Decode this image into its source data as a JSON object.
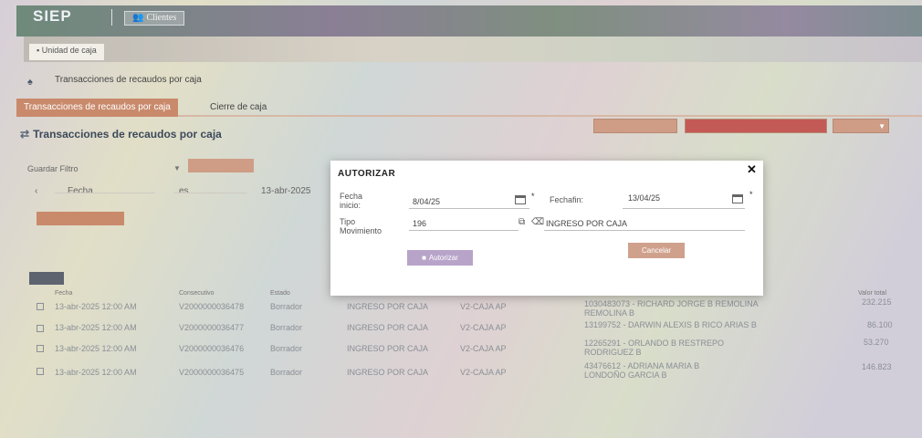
{
  "header": {
    "logo": "SIEP",
    "clientes_label": "Clientes",
    "unidad_tab": "Unidad de caja"
  },
  "breadcrumb": {
    "page": "Transacciones de recaudos por caja"
  },
  "tabs": [
    {
      "label": "Transacciones de recaudos por caja"
    },
    {
      "label": "Cierre de caja"
    }
  ],
  "section": {
    "title": "Transacciones de recaudos por caja"
  },
  "filters": {
    "guardar_label": "Guardar Filtro",
    "field1": "Fecha",
    "field2": "es",
    "field3": "13-abr-2025"
  },
  "table": {
    "headers": [
      "Fecha",
      "Consecutivo",
      "Estado",
      "Valor total"
    ],
    "rows": [
      {
        "fecha": "13-abr-2025 12:00 AM",
        "consecutivo": "V2000000036478",
        "estado": "Borrador",
        "tipo": "INGRESO POR CAJA",
        "caja": "V2-CAJA AP",
        "tercero": "1030483073 - RICHARD JORGE B REMOLINA REMOLINA B",
        "valor": "232.215"
      },
      {
        "fecha": "13-abr-2025 12:00 AM",
        "consecutivo": "V2000000036477",
        "estado": "Borrador",
        "tipo": "INGRESO POR CAJA",
        "caja": "V2-CAJA AP",
        "tercero": "13199752 - DARWIN ALEXIS B RICO ARIAS B",
        "valor": "86.100"
      },
      {
        "fecha": "13-abr-2025 12:00 AM",
        "consecutivo": "V2000000036476",
        "estado": "Borrador",
        "tipo": "INGRESO POR CAJA",
        "caja": "V2-CAJA AP",
        "tercero": "12265291 - ORLANDO B RESTREPO RODRIGUEZ B",
        "valor": "53.270"
      },
      {
        "fecha": "13-abr-2025 12:00 AM",
        "consecutivo": "V2000000036475",
        "estado": "Borrador",
        "tipo": "INGRESO POR CAJA",
        "caja": "V2-CAJA AP",
        "tercero": "43476612 - ADRIANA MARIA B LONDOÑO GARCIA B",
        "valor": "146.823"
      }
    ]
  },
  "modal": {
    "title": "AUTORIZAR",
    "fecha_inicio_label": "Fecha inicio:",
    "fecha_inicio_value": "8/04/25",
    "fecha_fin_label": "Fechafin:",
    "fecha_fin_value": "13/04/25",
    "tipo_label": "Tipo Movimiento",
    "tipo_code": "196",
    "tipo_desc": "INGRESO POR CAJA",
    "ok_label": "Autorizar",
    "cancel_label": "Cancelar",
    "required_mark": "*"
  },
  "colors": {
    "accent": "#c98a6c",
    "modal_ok": "#b8a4c9",
    "modal_cancel": "#cfa18c",
    "grid_button": "#5d6470"
  }
}
